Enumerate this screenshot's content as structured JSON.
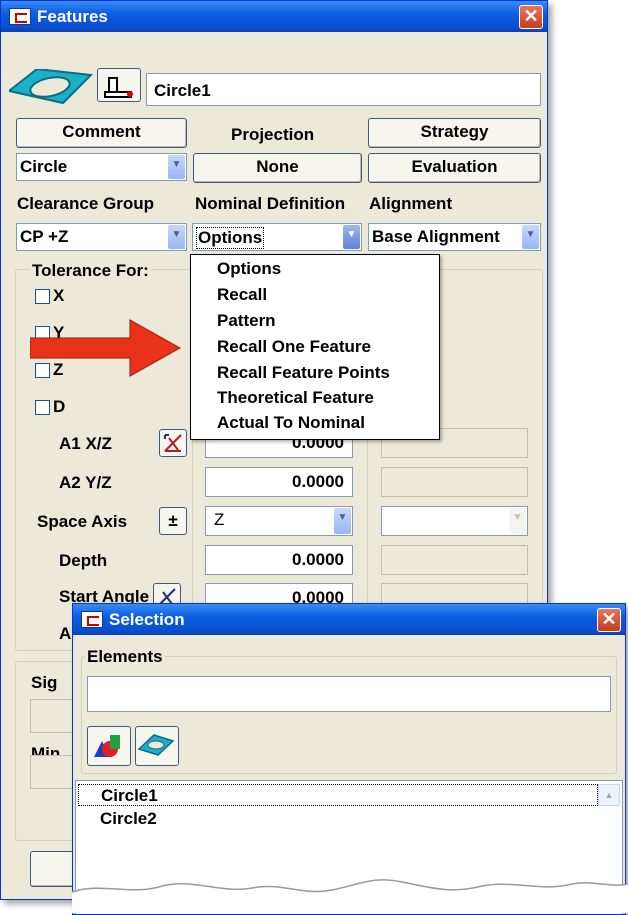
{
  "features": {
    "title": "Features",
    "name_value": "Circle1",
    "comment_label": "Comment",
    "projection_label": "Projection",
    "strategy_label": "Strategy",
    "type_value": "Circle",
    "projection_value": "None",
    "evaluation_label": "Evaluation",
    "clearance_group_label": "Clearance Group",
    "nominal_definition_label": "Nominal Definition",
    "alignment_label": "Alignment",
    "clearance_value": "CP +Z",
    "nominal_value": "Options",
    "alignment_value": "Base Alignment",
    "tolerance_for_label": "Tolerance For:",
    "x_label": "X",
    "y_label": "Y",
    "z_label": "Z",
    "d_label": "D",
    "a1_label": "A1 X/Z",
    "a1_value": "0.0000",
    "a2_label": "A2 Y/Z",
    "a2_value": "0.0000",
    "space_axis_label": "Space Axis",
    "space_axis_value": "Z",
    "depth_label": "Depth",
    "depth_value": "0.0000",
    "start_angle_label": "Start Angle",
    "start_angle_value": "0.0000",
    "partial_a_label": "A",
    "partial_sig_label": "Sig",
    "partial_min_label": "Min",
    "plus_minus_symbol": "±"
  },
  "dropdown": {
    "items": [
      "Options",
      "Recall",
      "Pattern",
      "Recall One Feature",
      "Recall Feature Points",
      "Theoretical Feature",
      "Actual To Nominal"
    ]
  },
  "selection": {
    "title": "Selection",
    "elements_label": "Elements",
    "items": [
      "Circle1",
      "Circle2"
    ]
  },
  "colors": {
    "titlebar": "#0a4fd0",
    "arrow": "#e8321a",
    "window_bg": "#ece9d8"
  },
  "icons": [
    "circle-feature-icon",
    "probe-icon",
    "close-icon",
    "chevron-down-icon",
    "shapes-icon",
    "circle-shape-icon",
    "scroll-up-icon",
    "arrow-annotation"
  ]
}
